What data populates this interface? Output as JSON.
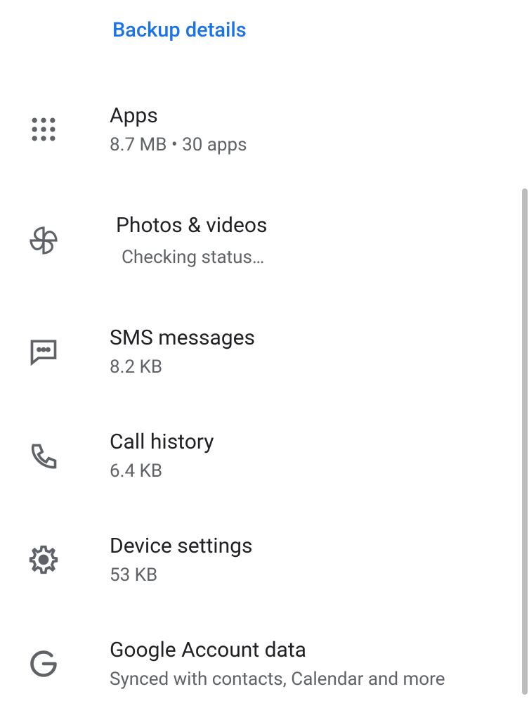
{
  "header": "Backup details",
  "items": [
    {
      "title": "Apps",
      "subtitle": "8.7 MB • 30 apps"
    },
    {
      "title": "Photos & videos",
      "subtitle": "Checking status…"
    },
    {
      "title": "SMS messages",
      "subtitle": "8.2 KB"
    },
    {
      "title": "Call history",
      "subtitle": "6.4 KB"
    },
    {
      "title": "Device settings",
      "subtitle": "53 KB"
    },
    {
      "title": "Google Account data",
      "subtitle": "Synced with contacts, Calendar and more"
    }
  ]
}
